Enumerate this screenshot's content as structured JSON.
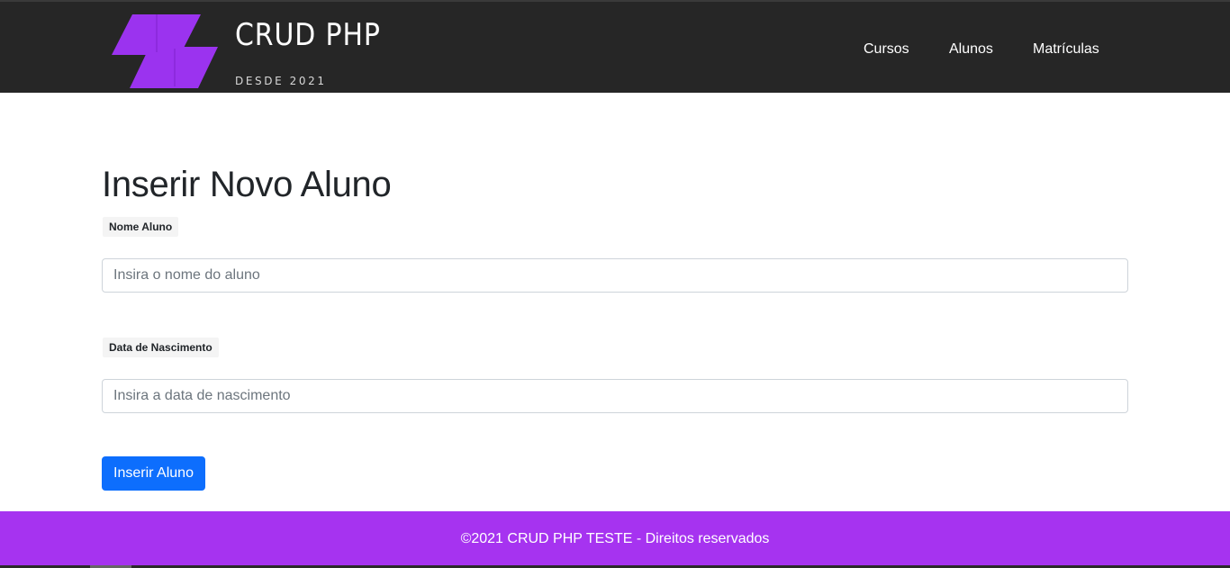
{
  "header": {
    "logo_icon": "crud-php-logo",
    "brand_title": "CRUD PHP",
    "brand_subtitle": "DESDE 2021",
    "nav": [
      {
        "label": "Cursos"
      },
      {
        "label": "Alunos"
      },
      {
        "label": "Matrículas"
      }
    ],
    "colors": {
      "background": "#262626",
      "logo": "#9b33ef"
    }
  },
  "form": {
    "title": "Inserir Novo Aluno",
    "nome": {
      "label": "Nome Aluno",
      "value": "",
      "placeholder": "Insira o nome do aluno"
    },
    "data_nascimento": {
      "label": "Data de Nascimento",
      "value": "",
      "placeholder": "Insira a data de nascimento"
    },
    "submit_label": "Inserir Aluno",
    "colors": {
      "submit": "#0d6efd"
    }
  },
  "footer": {
    "text": "©2021 CRUD PHP TESTE - Direitos reservados",
    "colors": {
      "background": "#a633f0"
    }
  }
}
